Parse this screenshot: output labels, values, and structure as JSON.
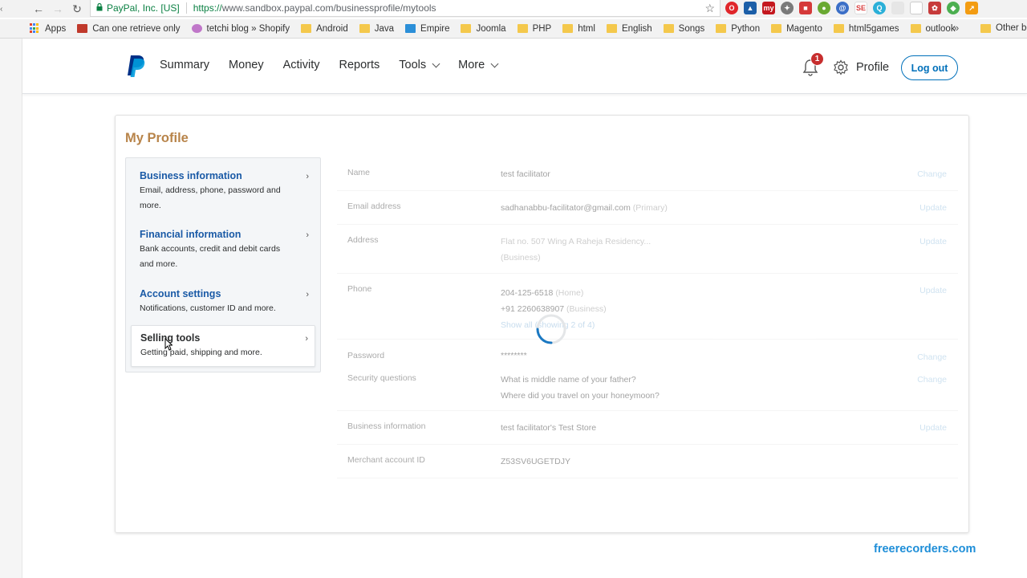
{
  "browser": {
    "secure_label": "PayPal, Inc. [US]",
    "url_https": "https://",
    "url_rest": "www.sandbox.paypal.com/businessprofile/mytools",
    "bookmarks": [
      {
        "label": "Apps"
      },
      {
        "label": "Can one retrieve only"
      },
      {
        "label": "tetchi blog » Shopify"
      },
      {
        "label": "Android"
      },
      {
        "label": "Java"
      },
      {
        "label": "Empire"
      },
      {
        "label": "Joomla"
      },
      {
        "label": "PHP"
      },
      {
        "label": "html"
      },
      {
        "label": "English"
      },
      {
        "label": "Songs"
      },
      {
        "label": "Python"
      },
      {
        "label": "Magento"
      },
      {
        "label": "html5games"
      },
      {
        "label": "outlook"
      }
    ],
    "more_bookmarks": "»",
    "other_bookmarks": "Other bo"
  },
  "header": {
    "nav": [
      "Summary",
      "Money",
      "Activity",
      "Reports",
      "Tools",
      "More"
    ],
    "notification_count": "1",
    "profile_label": "Profile",
    "logout_label": "Log out"
  },
  "profile": {
    "title": "My Profile",
    "side_items": [
      {
        "title": "Business information",
        "desc": "Email, address, phone, password and more."
      },
      {
        "title": "Financial information",
        "desc": "Bank accounts, credit and debit cards and more."
      },
      {
        "title": "Account settings",
        "desc": "Notifications, customer ID and more."
      },
      {
        "title": "Selling tools",
        "desc": "Getting paid, shipping and more."
      }
    ],
    "rows": {
      "name": {
        "label": "Name",
        "value": "test facilitator",
        "action": "Change"
      },
      "email": {
        "label": "Email address",
        "value": "sadhanabbu-facilitator@gmail.com",
        "tag": "(Primary)",
        "action": "Update"
      },
      "address": {
        "label": "Address",
        "value": "Flat no. 507 Wing A Raheja Residency...",
        "tag": "(Business)",
        "action": "Update"
      },
      "phone": {
        "label": "Phone",
        "line1": "204-125-6518",
        "tag1": "(Home)",
        "line2": "+91 2260638907",
        "tag2": "(Business)",
        "show_all": "Show all (showing 2 of 4)",
        "action": "Update"
      },
      "password": {
        "label": "Password",
        "value": "********",
        "action": "Change"
      },
      "security": {
        "label": "Security questions",
        "q1": "What is middle name of your father?",
        "q2": "Where did you travel on your honeymoon?",
        "action": "Change"
      },
      "business": {
        "label": "Business information",
        "value": "test facilitator's Test Store",
        "action": "Update"
      },
      "merchant": {
        "label": "Merchant account ID",
        "value": "Z53SV6UGETDJY"
      }
    }
  },
  "watermark": "freerecorders.com",
  "colors": {
    "brand_blue": "#0070ba",
    "title_brown": "#b8844a",
    "badge_red": "#c72e2e"
  }
}
